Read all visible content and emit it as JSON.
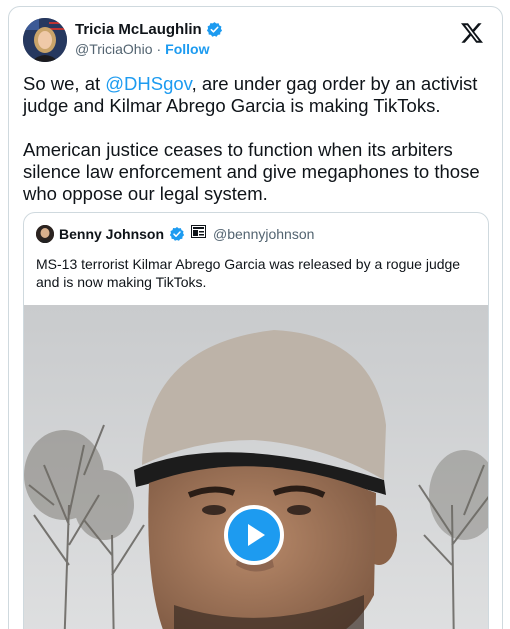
{
  "post": {
    "author_name": "Tricia McLaughlin",
    "author_handle": "@TriciaOhio",
    "separator": "·",
    "follow_label": "Follow",
    "text_part1": "So we, at ",
    "mention": "@DHSgov",
    "text_part2": ", are under gag order by an activist judge and Kilmar Abrego Garcia is making TikToks.\n\nAmerican justice ceases to function when its arbiters silence law enforcement and give megaphones to those who oppose our legal system."
  },
  "quoted": {
    "author_name": "Benny Johnson",
    "author_handle": "@bennyjohnson",
    "text": "MS-13 terrorist Kilmar Abrego Garcia was released by a rogue judge and is now making TikToks."
  },
  "icons": {
    "verified": "verified-badge-icon",
    "x_logo": "x-logo-icon",
    "play": "play-icon",
    "affiliate": "affiliate-badge-icon"
  },
  "colors": {
    "accent": "#1d9bf0",
    "text": "#0f1419",
    "muted": "#536471",
    "border": "#cfd9de"
  }
}
